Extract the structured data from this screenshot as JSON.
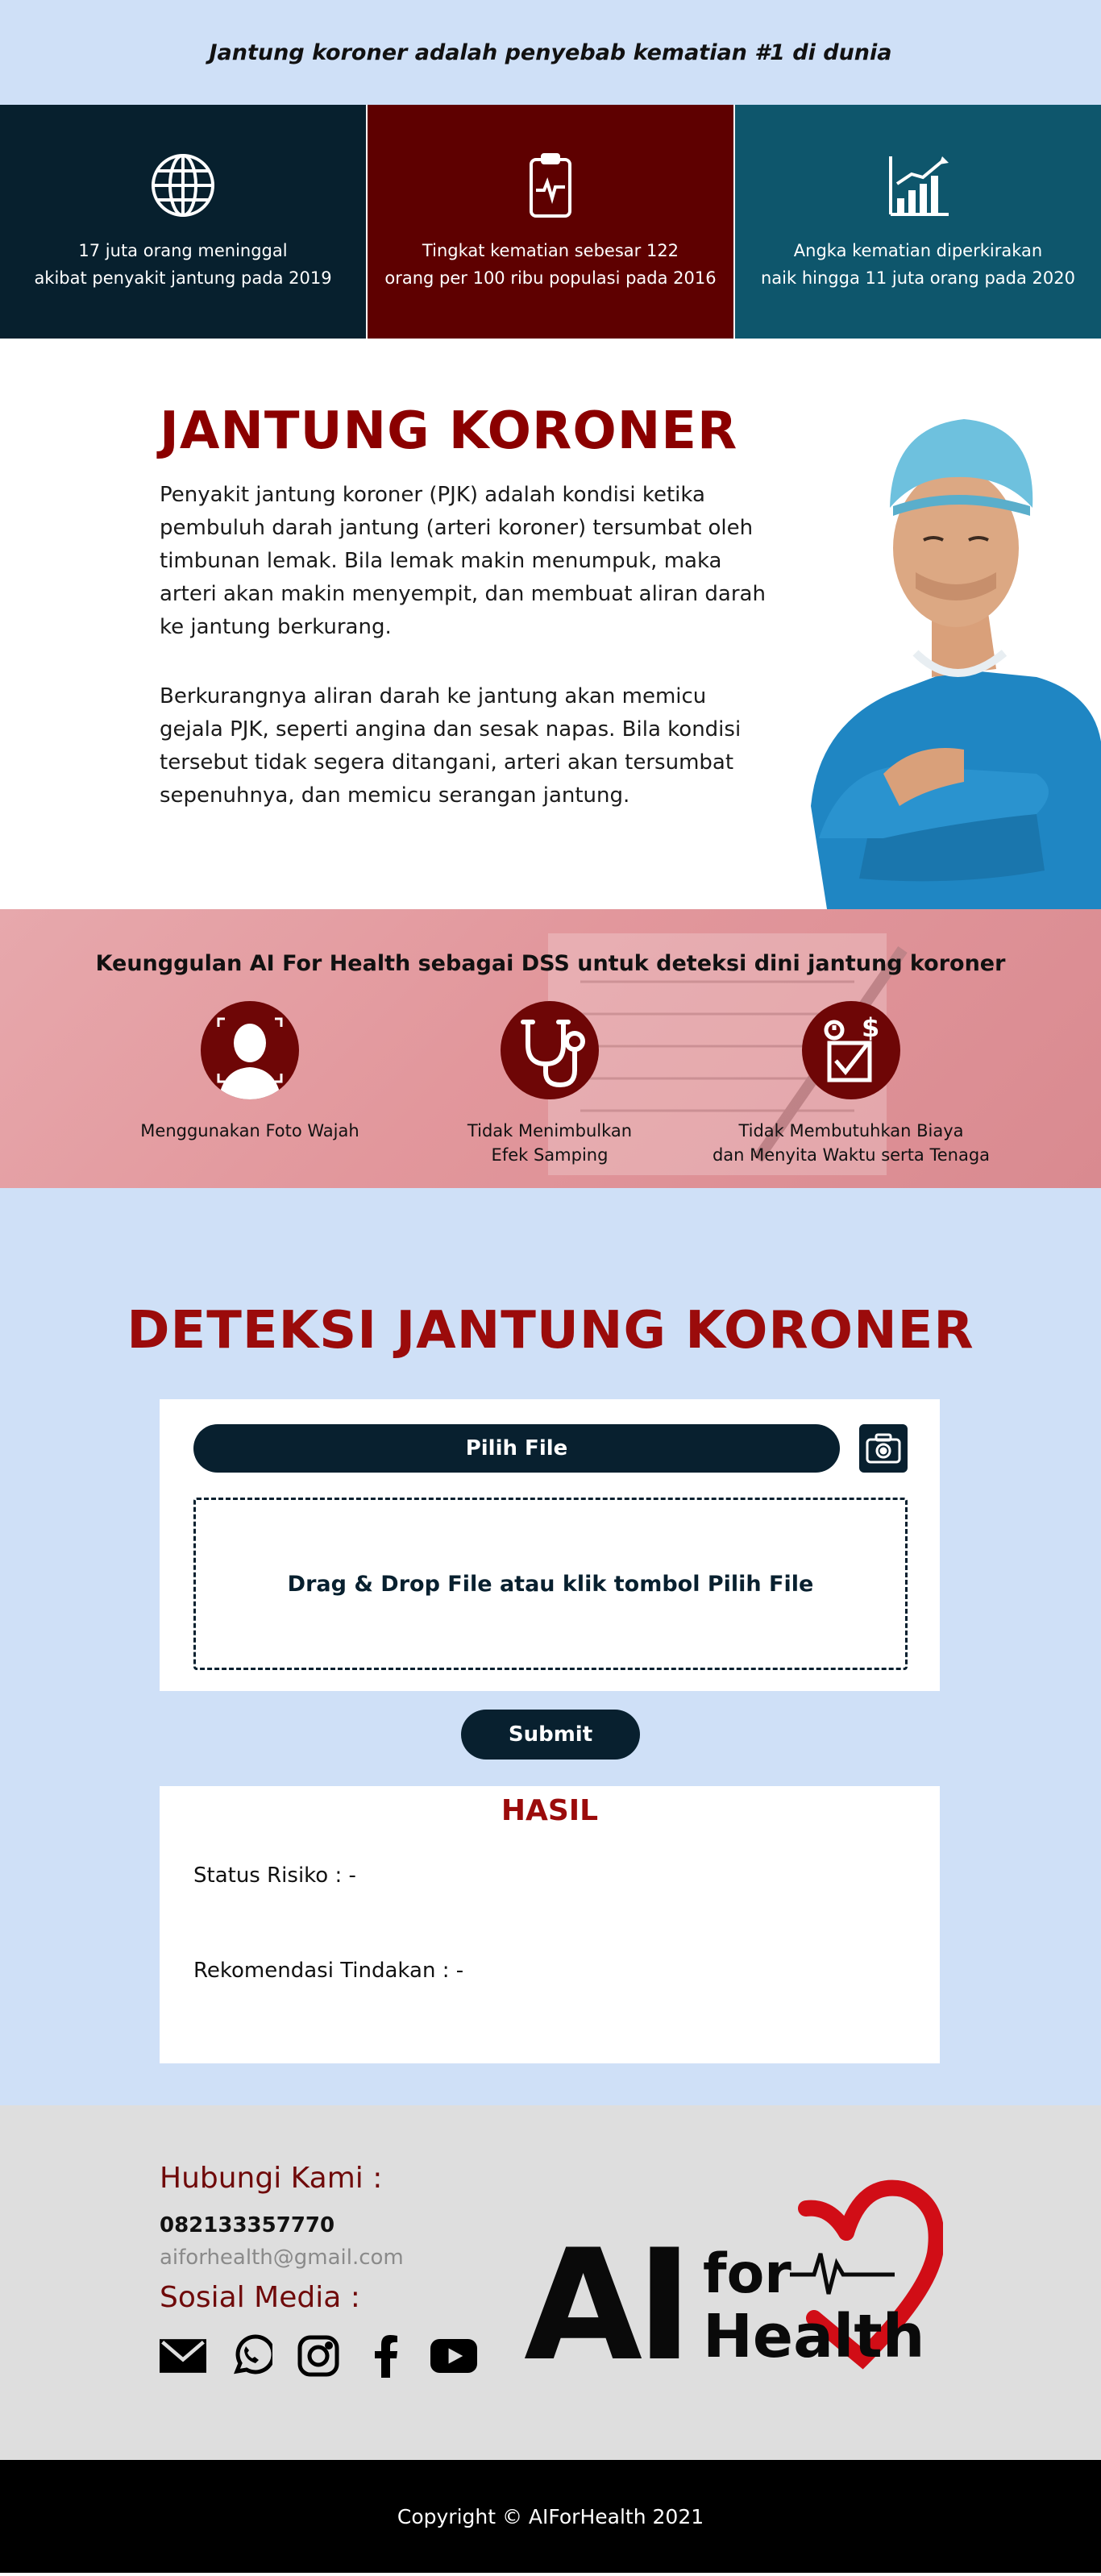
{
  "banner": {
    "text": "Jantung koroner adalah penyebab kematian #1 di dunia"
  },
  "stats": [
    {
      "icon": "globe-icon",
      "line1": "17 juta orang meninggal",
      "line2": "akibat penyakit jantung pada 2019",
      "color": "#07202e"
    },
    {
      "icon": "heart-monitor-icon",
      "line1": "Tingkat kematian sebesar 122",
      "line2": "orang per 100 ribu populasi pada 2016",
      "color": "#5e0000"
    },
    {
      "icon": "growth-chart-icon",
      "line1": "Angka kematian diperkirakan",
      "line2": "naik hingga 11 juta orang pada 2020",
      "color": "#0e566c"
    }
  ],
  "about": {
    "title": "JANTUNG KORONER",
    "paragraph1": "Penyakit jantung koroner (PJK) adalah kondisi ketika pembuluh darah jantung (arteri koroner) tersumbat oleh timbunan lemak. Bila lemak makin menumpuk, maka arteri akan makin menyempit, dan membuat aliran darah ke jantung berkurang.",
    "paragraph2": "Berkurangnya aliran darah ke jantung akan memicu gejala PJK, seperti angina dan sesak napas. Bila kondisi tersebut tidak segera ditangani, arteri akan tersumbat sepenuhnya, dan memicu serangan jantung."
  },
  "advantages": {
    "title": "Keunggulan AI For Health sebagai DSS untuk deteksi dini jantung koroner",
    "items": [
      {
        "icon": "face-scan-icon",
        "line1": "Menggunakan Foto Wajah",
        "line2": ""
      },
      {
        "icon": "stethoscope-icon",
        "line1": "Tidak Menimbulkan",
        "line2": "Efek Samping"
      },
      {
        "icon": "cost-time-checklist-icon",
        "line1": "Tidak Membutuhkan Biaya",
        "line2": "dan Menyita Waktu serta Tenaga"
      }
    ]
  },
  "detection": {
    "title": "DETEKSI JANTUNG KORONER",
    "pick_file_label": "Pilih File",
    "drop_zone_text": "Drag & Drop File atau klik tombol Pilih File",
    "submit_label": "Submit",
    "result_title": "HASIL",
    "status_line": "Status Risiko : -",
    "recommendation_line": "Rekomendasi Tindakan : -"
  },
  "contact": {
    "title": "Hubungi Kami :",
    "phone": "082133357770",
    "email": "aiforhealth@gmail.com",
    "social_title": "Sosial Media :",
    "socials": [
      "mail-icon",
      "whatsapp-icon",
      "instagram-icon",
      "facebook-icon",
      "youtube-icon"
    ],
    "logo": {
      "big": "AI",
      "top": "for",
      "bottom": "Health"
    }
  },
  "footer": {
    "copyright": "Copyright © AIForHealth 2021"
  },
  "colors": {
    "accent": "#9b0b0b",
    "navy": "#08202f",
    "light_blue": "#cfe0f7",
    "pink": "#e2979c"
  }
}
